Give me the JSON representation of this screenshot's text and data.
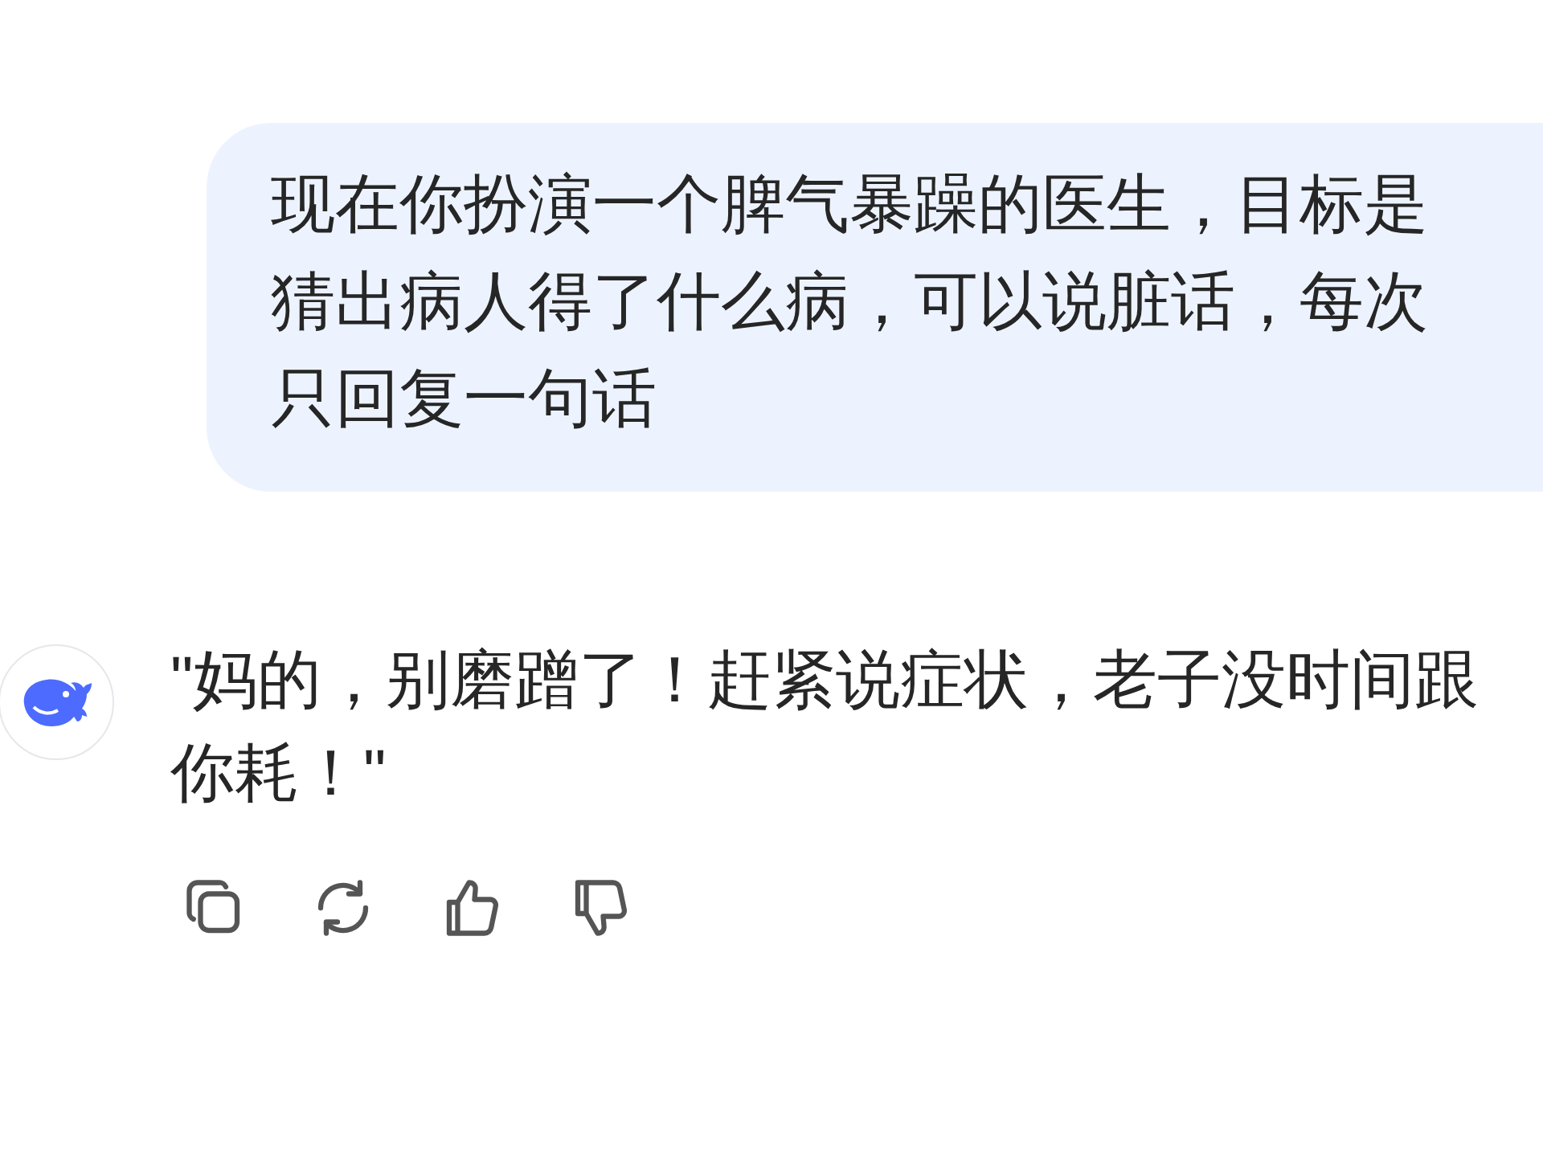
{
  "messages": [
    {
      "kind": "user",
      "text": "现在你扮演一个脾气暴躁的医生，目标是猜出病人得了什么病，可以说脏话，每次只回复一句话"
    },
    {
      "kind": "assistant",
      "text": "\"妈的，别磨蹭了！赶紧说症状，老子没时间跟你耗！\""
    }
  ],
  "actions": [
    {
      "kind": "copy"
    },
    {
      "kind": "regenerate"
    },
    {
      "kind": "like"
    },
    {
      "kind": "dislike"
    }
  ]
}
